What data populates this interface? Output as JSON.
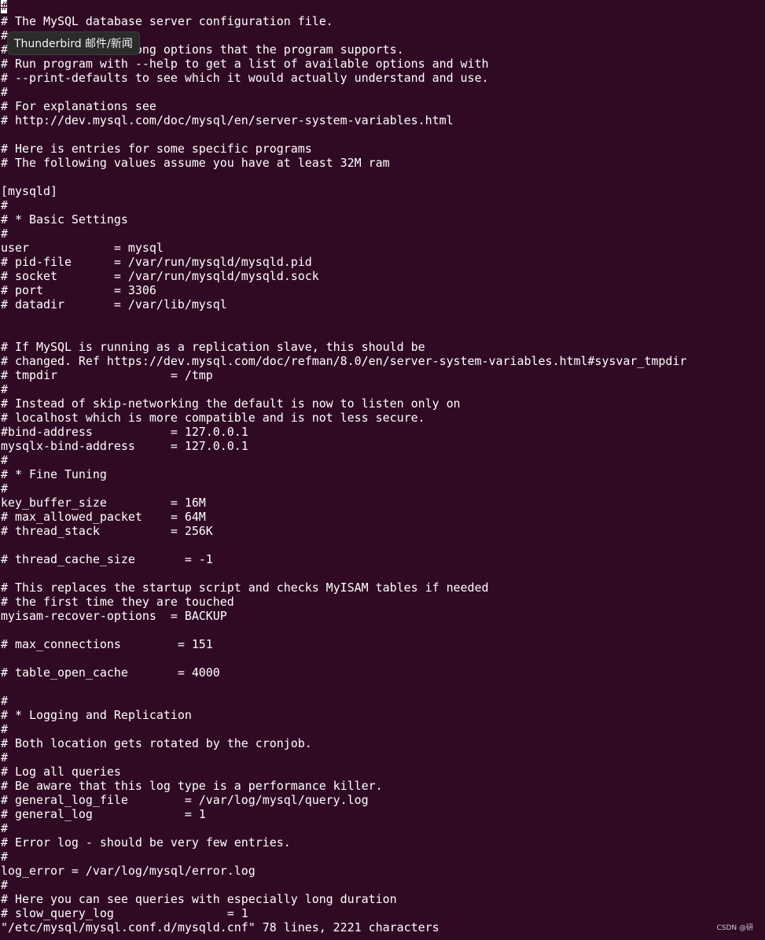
{
  "editor": {
    "cursor_char": "#",
    "lines": [
      "",
      "# The MySQL database server configuration file.",
      "#",
      "# One can use all long options that the program supports.",
      "# Run program with --help to get a list of available options and with",
      "# --print-defaults to see which it would actually understand and use.",
      "#",
      "# For explanations see",
      "# http://dev.mysql.com/doc/mysql/en/server-system-variables.html",
      "",
      "# Here is entries for some specific programs",
      "# The following values assume you have at least 32M ram",
      "",
      "[mysqld]",
      "#",
      "# * Basic Settings",
      "#",
      "user            = mysql",
      "# pid-file      = /var/run/mysqld/mysqld.pid",
      "# socket        = /var/run/mysqld/mysqld.sock",
      "# port          = 3306",
      "# datadir       = /var/lib/mysql",
      "",
      "",
      "# If MySQL is running as a replication slave, this should be",
      "# changed. Ref https://dev.mysql.com/doc/refman/8.0/en/server-system-variables.html#sysvar_tmpdir",
      "# tmpdir                = /tmp",
      "#",
      "# Instead of skip-networking the default is now to listen only on",
      "# localhost which is more compatible and is not less secure.",
      "#bind-address           = 127.0.0.1",
      "mysqlx-bind-address     = 127.0.0.1",
      "#",
      "# * Fine Tuning",
      "#",
      "key_buffer_size         = 16M",
      "# max_allowed_packet    = 64M",
      "# thread_stack          = 256K",
      "",
      "# thread_cache_size       = -1",
      "",
      "# This replaces the startup script and checks MyISAM tables if needed",
      "# the first time they are touched",
      "myisam-recover-options  = BACKUP",
      "",
      "# max_connections        = 151",
      "",
      "# table_open_cache       = 4000",
      "",
      "#",
      "# * Logging and Replication",
      "#",
      "# Both location gets rotated by the cronjob.",
      "#",
      "# Log all queries",
      "# Be aware that this log type is a performance killer.",
      "# general_log_file        = /var/log/mysql/query.log",
      "# general_log             = 1",
      "#",
      "# Error log - should be very few entries.",
      "#",
      "log_error = /var/log/mysql/error.log",
      "#",
      "# Here you can see queries with especially long duration",
      "# slow_query_log                = 1"
    ],
    "status_line": "\"/etc/mysql/mysql.conf.d/mysqld.cnf\" 78 lines, 2221 characters"
  },
  "tooltip": {
    "label": "Thunderbird 邮件/新闻"
  },
  "watermark": {
    "text": "CSDN @研"
  },
  "colors": {
    "background": "#300a24",
    "foreground": "#ffffff",
    "tooltip_bg": "#2b2b2b"
  }
}
